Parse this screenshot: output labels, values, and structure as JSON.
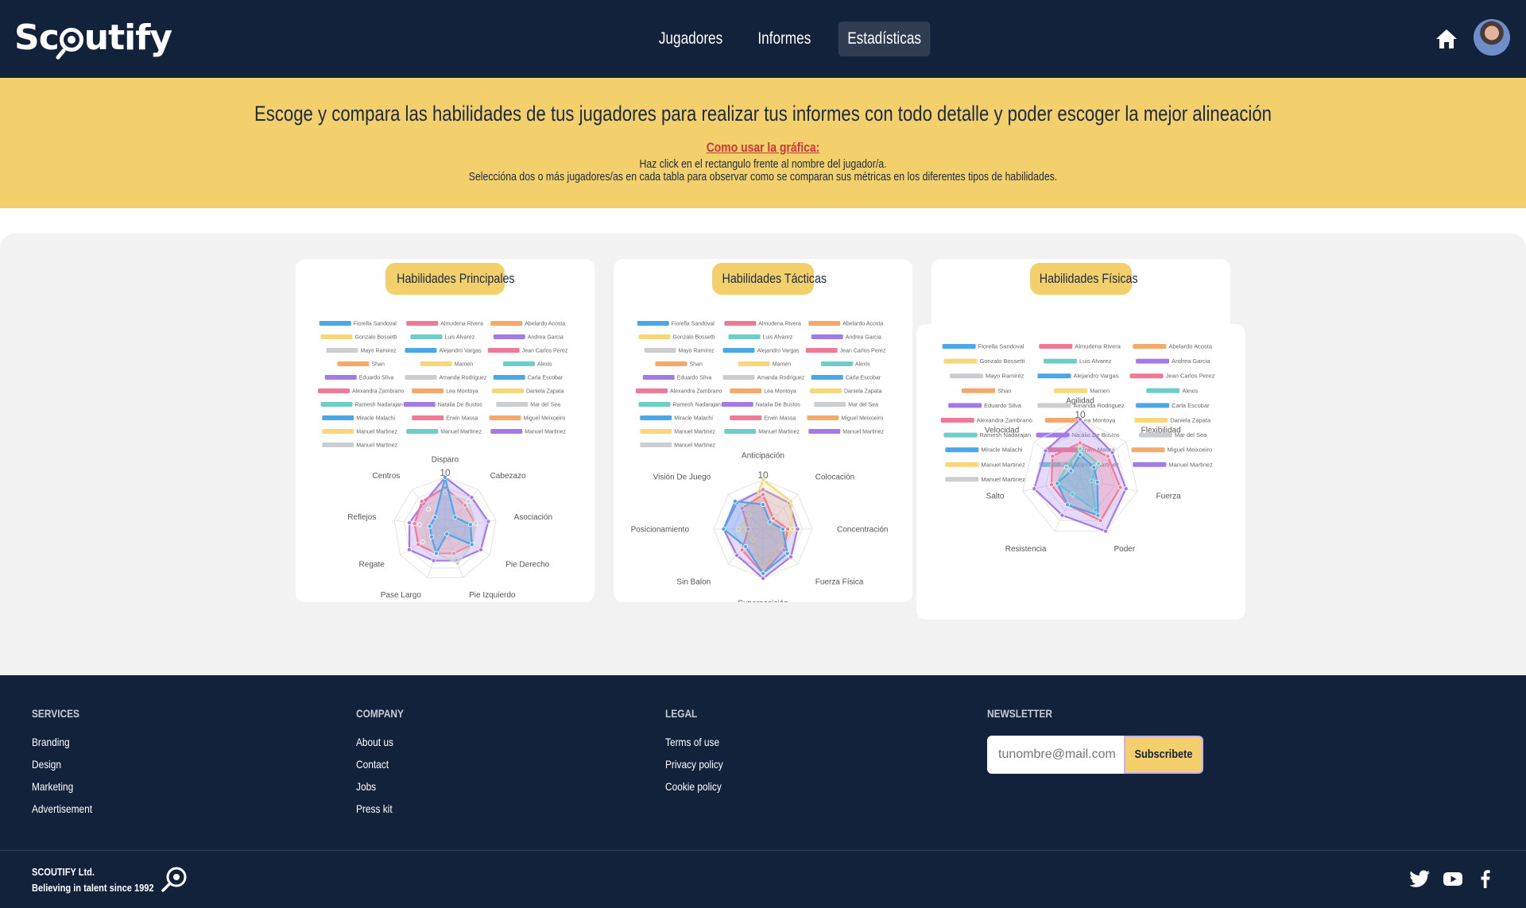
{
  "brand": {
    "name_pre": "Sc",
    "name_post": "utify"
  },
  "nav": {
    "links": [
      {
        "label": "Jugadores"
      },
      {
        "label": "Informes"
      },
      {
        "label": "Estadísticas"
      }
    ],
    "active": "Estadísticas",
    "home_icon": "home-icon",
    "avatar": "user-avatar"
  },
  "banner": {
    "title": "Escoge y compara las habilidades de tus jugadores para realizar tus informes con todo detalle y poder escoger la mejor alineación",
    "how_title": "Como usar la gráfica:",
    "how_line1": "Haz click en el rectangulo frente al nombre del jugador/a.",
    "how_line2": "Seleccióna dos o más jugadores/as en cada tabla para observar como se comparan sus métricas en los diferentes tipos de habilidades."
  },
  "players": [
    {
      "name": "Fiorella Sandoval",
      "color": "#4aa8e8"
    },
    {
      "name": "Almudena Rivera",
      "color": "#f07a95"
    },
    {
      "name": "Abelardo Acosta",
      "color": "#f4a86a"
    },
    {
      "name": "Gonzalo Bossetti",
      "color": "#f7d77a"
    },
    {
      "name": "Luis Alvarez",
      "color": "#6ccdc9"
    },
    {
      "name": "Andrea Garcia",
      "color": "#a27be8"
    },
    {
      "name": "Mayo Ramirez",
      "color": "#cbcdd1"
    },
    {
      "name": "Alejandro Vargas",
      "color": "#4aa8e8"
    },
    {
      "name": "Jean Carlos Perez",
      "color": "#f07a95"
    },
    {
      "name": "Shan",
      "color": "#f4a86a"
    },
    {
      "name": "Mamen",
      "color": "#f7d77a"
    },
    {
      "name": "Alexis",
      "color": "#6ccdc9"
    },
    {
      "name": "Eduardo Silva",
      "color": "#a27be8"
    },
    {
      "name": "Amanda Rodriguez",
      "color": "#cbcdd1"
    },
    {
      "name": "Carla Escobar",
      "color": "#4aa8e8"
    },
    {
      "name": "Alexandra Zambrano",
      "color": "#f07a95"
    },
    {
      "name": "Lea Montoya",
      "color": "#f4a86a"
    },
    {
      "name": "Daniela Zapata",
      "color": "#f7d77a"
    },
    {
      "name": "Ramesh Nadarajan",
      "color": "#6ccdc9"
    },
    {
      "name": "Natalia De Bustos",
      "color": "#a27be8"
    },
    {
      "name": "Mar del Sea",
      "color": "#cbcdd1"
    },
    {
      "name": "Miracle Malachi",
      "color": "#4aa8e8"
    },
    {
      "name": "Erwin Massa",
      "color": "#f07a95"
    },
    {
      "name": "Miguel Meixoeiro",
      "color": "#f4a86a"
    },
    {
      "name": "Manuel Martinez",
      "color": "#f7d77a"
    },
    {
      "name": "Manuel Martinez",
      "color": "#6ccdc9"
    },
    {
      "name": "Manuel Martinez",
      "color": "#a27be8"
    },
    {
      "name": "Manuel Martinez",
      "color": "#cbcdd1"
    }
  ],
  "charts": [
    {
      "title": "Habilidades Principales",
      "axes": [
        "Disparo",
        "Cabezazo",
        "Asociación",
        "Pie Derecho",
        "Pie Izquierdo",
        "Pase Largo",
        "Regate",
        "Reflejos",
        "Centros"
      ],
      "max_label": "10",
      "series": [
        {
          "color": "#a27be8",
          "values": [
            10,
            8,
            8.5,
            8,
            6.5,
            6.5,
            8,
            7,
            6.5
          ]
        },
        {
          "color": "#f07a95",
          "values": [
            8,
            6,
            6,
            6,
            5,
            5,
            6,
            6,
            7
          ]
        },
        {
          "color": "#cbcdd1",
          "values": [
            7,
            7,
            6,
            6,
            7,
            5,
            5,
            5,
            5
          ]
        },
        {
          "color": "#4aa8e8",
          "values": [
            10,
            3,
            5,
            6,
            1,
            5,
            3,
            3,
            3
          ]
        }
      ]
    },
    {
      "title": "Habilidades Tácticas",
      "axes": [
        "Anticipación",
        "Colocación",
        "Concentración",
        "Fuerza Física",
        "Superposición",
        "Sin Balon",
        "Posicionamiento",
        "Visión De Juego"
      ],
      "max_label": "10",
      "series": [
        {
          "color": "#a27be8",
          "values": [
            8,
            7.5,
            7,
            8,
            10,
            7.5,
            8,
            7.5
          ]
        },
        {
          "color": "#f7d77a",
          "values": [
            10,
            8,
            6,
            5,
            8,
            3,
            5,
            4
          ]
        },
        {
          "color": "#f07a95",
          "values": [
            7,
            3,
            5,
            6,
            9,
            6,
            3,
            6
          ]
        },
        {
          "color": "#4aa8e8",
          "values": [
            5,
            2,
            4,
            7,
            9,
            5,
            8,
            8
          ]
        }
      ]
    },
    {
      "title": "Habilidades Físicas",
      "axes": [
        "Agilidad",
        "Flexibilidad",
        "Fuerza",
        "Poder",
        "Resistencia",
        "Salto",
        "Velocidad"
      ],
      "max_label": "10",
      "series": [
        {
          "color": "#a27be8",
          "values": [
            10,
            7,
            8,
            10,
            7,
            8,
            7.5
          ]
        },
        {
          "color": "#f07a95",
          "values": [
            6,
            6,
            7,
            8,
            5,
            5,
            6
          ]
        },
        {
          "color": "#6ccdc9",
          "values": [
            5,
            4,
            2,
            6,
            3,
            4,
            3
          ]
        },
        {
          "color": "#4aa8e8",
          "values": [
            4,
            3,
            3,
            7,
            5,
            4,
            2
          ]
        }
      ]
    }
  ],
  "footer": {
    "services": {
      "heading": "SERVICES",
      "items": [
        "Branding",
        "Design",
        "Marketing",
        "Advertisement"
      ]
    },
    "company": {
      "heading": "COMPANY",
      "items": [
        "About us",
        "Contact",
        "Jobs",
        "Press kit"
      ]
    },
    "legal": {
      "heading": "LEGAL",
      "items": [
        "Terms of use",
        "Privacy policy",
        "Cookie policy"
      ]
    },
    "newsletter": {
      "heading": "NEWSLETTER",
      "placeholder": "tunombre@mail.com",
      "button": "Subscribete"
    },
    "company_name": "SCOUTIFY Ltd.",
    "tagline": "Believing in talent since 1992",
    "social": [
      "twitter-icon",
      "youtube-icon",
      "facebook-icon"
    ]
  }
}
